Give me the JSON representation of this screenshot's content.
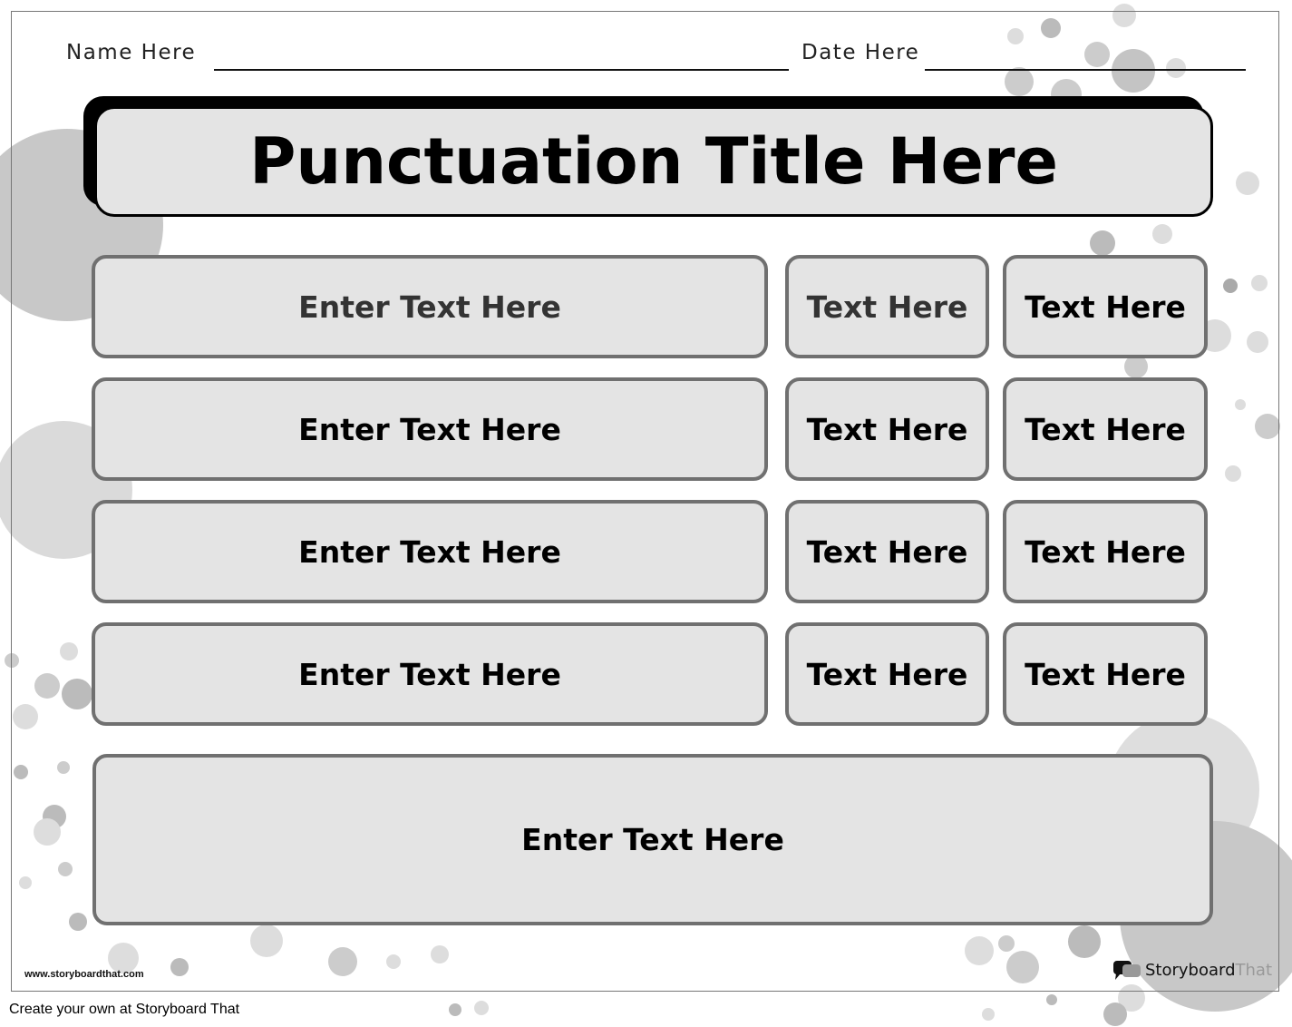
{
  "header": {
    "name_label": "Name Here",
    "date_label": "Date Here"
  },
  "title": "Punctuation Title Here",
  "rows": [
    [
      "Enter Text Here",
      "Text Here",
      "Text Here"
    ],
    [
      "Enter Text Here",
      "Text Here",
      "Text Here"
    ],
    [
      "Enter Text Here",
      "Text Here",
      "Text Here"
    ],
    [
      "Enter Text Here",
      "Text Here",
      "Text Here"
    ]
  ],
  "bottom_box": "Enter Text Here",
  "footer": {
    "website": "www.storyboardthat.com",
    "logo_text_1": "Storyboard",
    "logo_text_2": "That",
    "create_link": "Create your own at Storyboard That"
  },
  "colors": {
    "box_fill": "#e4e4e4",
    "box_border": "#707070",
    "decor": "#c8c8c8"
  }
}
